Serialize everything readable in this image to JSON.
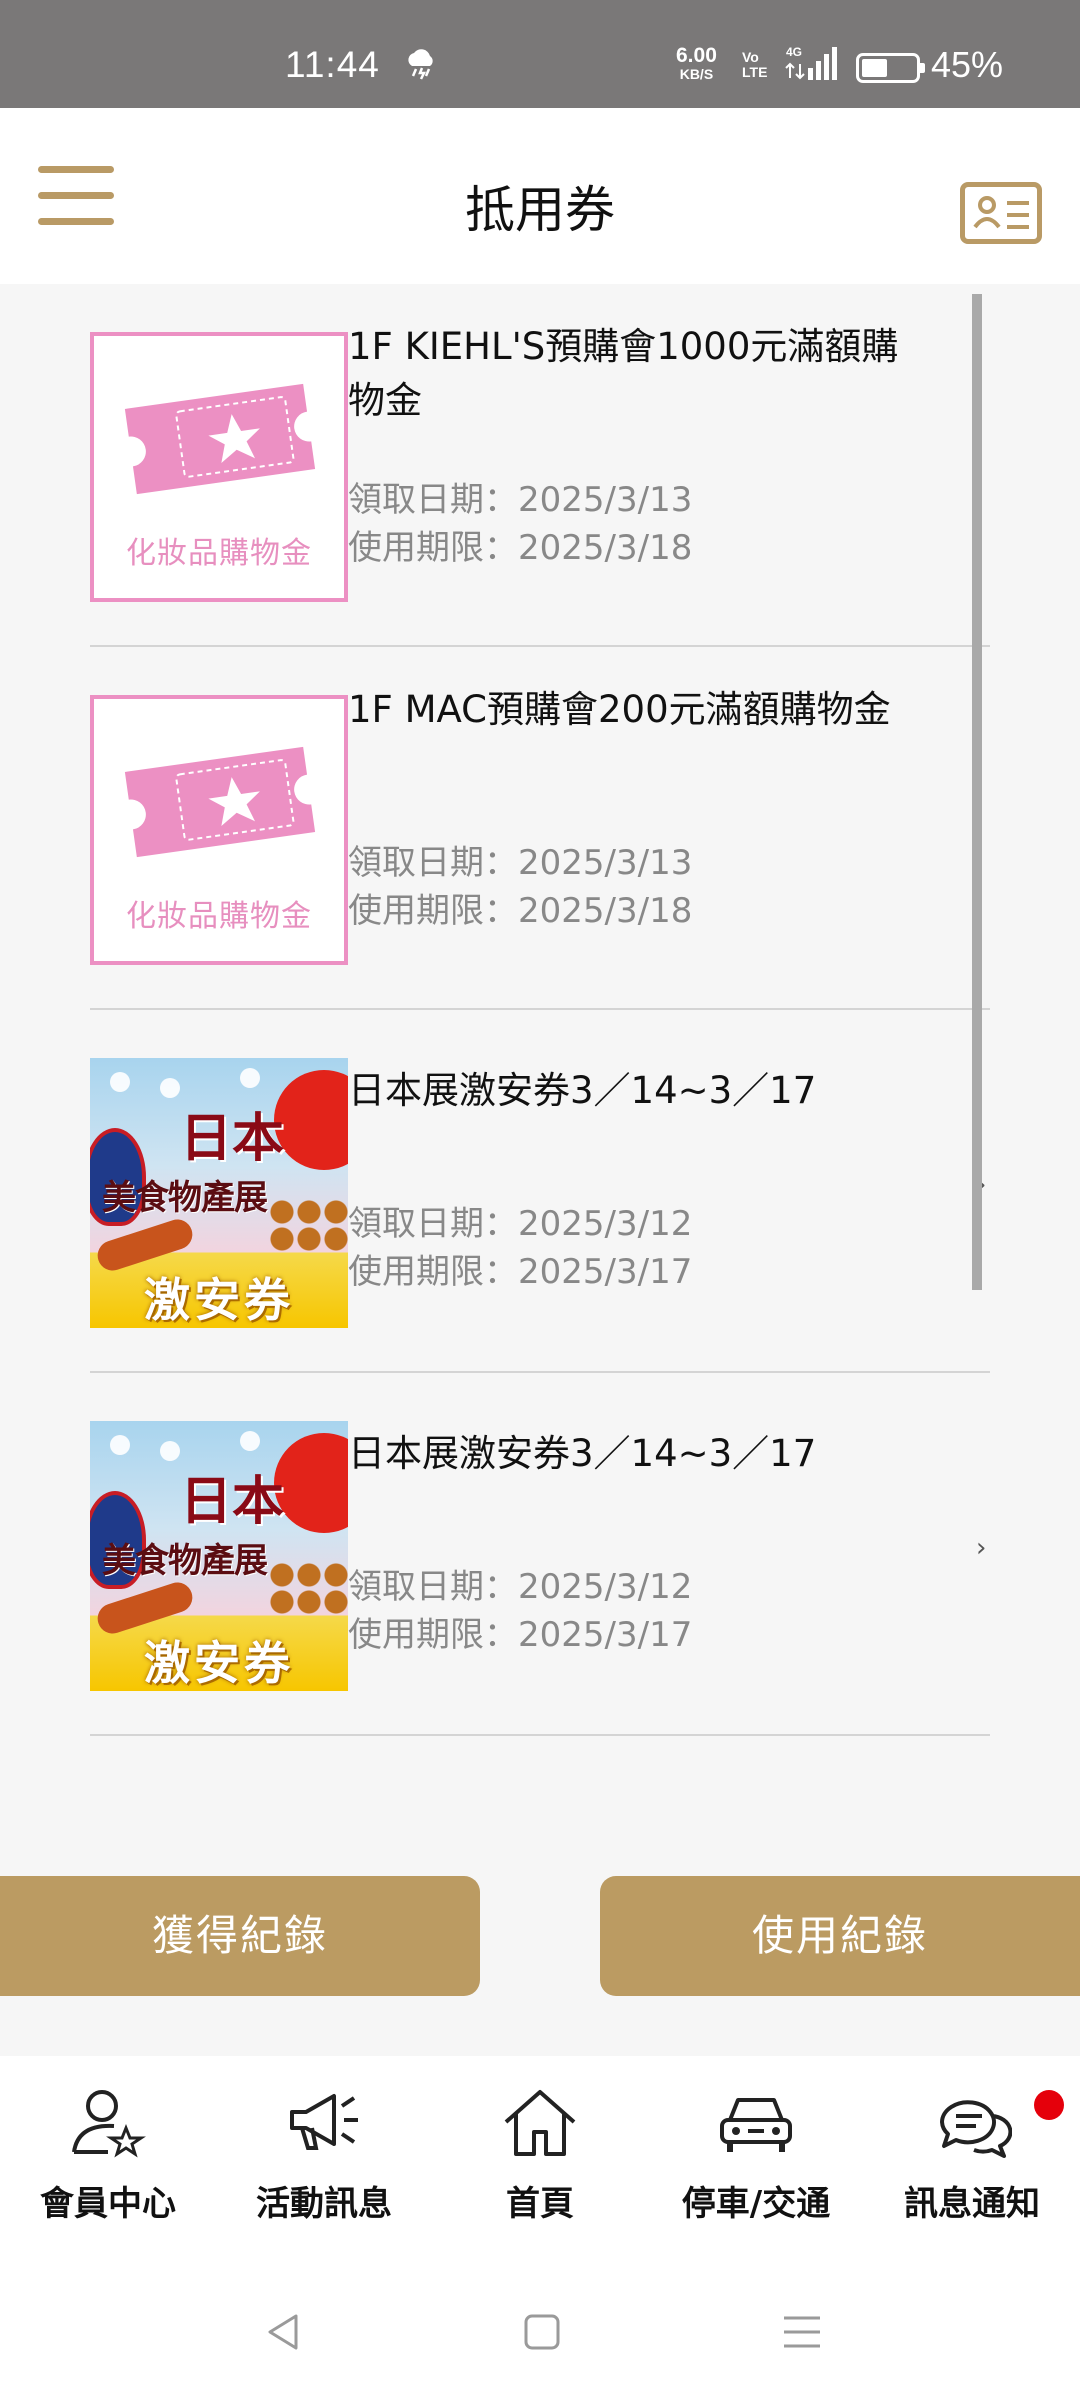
{
  "status_bar": {
    "time": "11:44",
    "weather_icon": "cloud-rain-lightning-icon",
    "net_speed": "6.00",
    "net_speed_unit": "KB/S",
    "volte_top": "Vo",
    "volte_bottom": "LTE",
    "network": "4G",
    "battery_percent": "45%"
  },
  "header": {
    "title": "抵用券",
    "menu_icon": "hamburger-menu-icon",
    "member_card_icon": "member-card-icon"
  },
  "coupons": [
    {
      "thumb_type": "cosmetics",
      "thumb_label": "化妝品購物金",
      "name": "1F KIEHL'S預購會1000元滿額購物金",
      "received": "領取日期：2025/3/13",
      "expires": "使用期限：2025/3/18",
      "has_chevron": false
    },
    {
      "thumb_type": "cosmetics",
      "thumb_label": "化妝品購物金",
      "name": "1F MAC預購會200元滿額購物金",
      "received": "領取日期：2025/3/13",
      "expires": "使用期限：2025/3/18",
      "has_chevron": false
    },
    {
      "thumb_type": "japan",
      "thumb_title": "日本",
      "thumb_sub": "美食物產展",
      "thumb_badge": "激安券",
      "name": "日本展激安券3／14~3／17",
      "received": "領取日期：2025/3/12",
      "expires": "使用期限：2025/3/17",
      "has_chevron": true
    },
    {
      "thumb_type": "japan",
      "thumb_title": "日本",
      "thumb_sub": "美食物產展",
      "thumb_badge": "激安券",
      "name": "日本展激安券3／14~3／17",
      "received": "領取日期：2025/3/12",
      "expires": "使用期限：2025/3/17",
      "has_chevron": true
    }
  ],
  "chevron": "›",
  "actions": {
    "obtained_records": "獲得紀錄",
    "usage_records": "使用紀錄"
  },
  "bottom_nav": [
    {
      "label": "會員中心",
      "icon": "member-star-icon"
    },
    {
      "label": "活動訊息",
      "icon": "megaphone-icon"
    },
    {
      "label": "首頁",
      "icon": "home-icon"
    },
    {
      "label": "停車/交通",
      "icon": "car-icon"
    },
    {
      "label": "訊息通知",
      "icon": "chat-bubbles-icon",
      "has_badge": true
    }
  ],
  "colors": {
    "accent_gold": "#bb9b62",
    "pink": "#ec90c3",
    "badge_red": "#e5000b"
  }
}
